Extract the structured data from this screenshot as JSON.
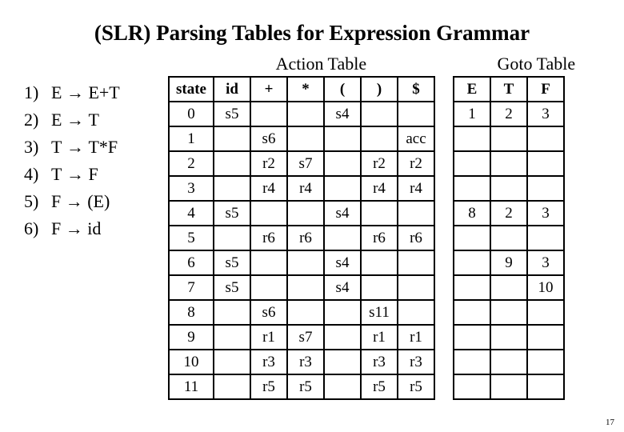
{
  "title": "(SLR) Parsing Tables for Expression Grammar",
  "action_heading": "Action Table",
  "goto_heading": "Goto Table",
  "arrow": " → ",
  "grammar": [
    {
      "num": "1)",
      "lhs": "E",
      "rhs": "E+T"
    },
    {
      "num": "2)",
      "lhs": "E",
      "rhs": "T"
    },
    {
      "num": "3)",
      "lhs": "T",
      "rhs": "T*F"
    },
    {
      "num": "4)",
      "lhs": "T",
      "rhs": "F"
    },
    {
      "num": "5)",
      "lhs": "F",
      "rhs": "(E)"
    },
    {
      "num": "6)",
      "lhs": "F",
      "rhs": "id"
    }
  ],
  "action_cols": [
    "id",
    "+",
    "*",
    "(",
    ")",
    "$"
  ],
  "goto_cols": [
    "E",
    "T",
    "F"
  ],
  "state_label": "state",
  "rows": [
    {
      "state": "0",
      "action": [
        "s5",
        "",
        "",
        "s4",
        "",
        ""
      ],
      "goto": [
        "1",
        "2",
        "3"
      ]
    },
    {
      "state": "1",
      "action": [
        "",
        "s6",
        "",
        "",
        "",
        "acc"
      ],
      "goto": [
        "",
        "",
        ""
      ]
    },
    {
      "state": "2",
      "action": [
        "",
        "r2",
        "s7",
        "",
        "r2",
        "r2"
      ],
      "goto": [
        "",
        "",
        ""
      ]
    },
    {
      "state": "3",
      "action": [
        "",
        "r4",
        "r4",
        "",
        "r4",
        "r4"
      ],
      "goto": [
        "",
        "",
        ""
      ]
    },
    {
      "state": "4",
      "action": [
        "s5",
        "",
        "",
        "s4",
        "",
        ""
      ],
      "goto": [
        "8",
        "2",
        "3"
      ]
    },
    {
      "state": "5",
      "action": [
        "",
        "r6",
        "r6",
        "",
        "r6",
        "r6"
      ],
      "goto": [
        "",
        "",
        ""
      ]
    },
    {
      "state": "6",
      "action": [
        "s5",
        "",
        "",
        "s4",
        "",
        ""
      ],
      "goto": [
        "",
        "9",
        "3"
      ]
    },
    {
      "state": "7",
      "action": [
        "s5",
        "",
        "",
        "s4",
        "",
        ""
      ],
      "goto": [
        "",
        "",
        "10"
      ]
    },
    {
      "state": "8",
      "action": [
        "",
        "s6",
        "",
        "",
        "s11",
        ""
      ],
      "goto": [
        "",
        "",
        ""
      ]
    },
    {
      "state": "9",
      "action": [
        "",
        "r1",
        "s7",
        "",
        "r1",
        "r1"
      ],
      "goto": [
        "",
        "",
        ""
      ]
    },
    {
      "state": "10",
      "action": [
        "",
        "r3",
        "r3",
        "",
        "r3",
        "r3"
      ],
      "goto": [
        "",
        "",
        ""
      ]
    },
    {
      "state": "11",
      "action": [
        "",
        "r5",
        "r5",
        "",
        "r5",
        "r5"
      ],
      "goto": [
        "",
        "",
        ""
      ]
    }
  ],
  "page_number": "17"
}
